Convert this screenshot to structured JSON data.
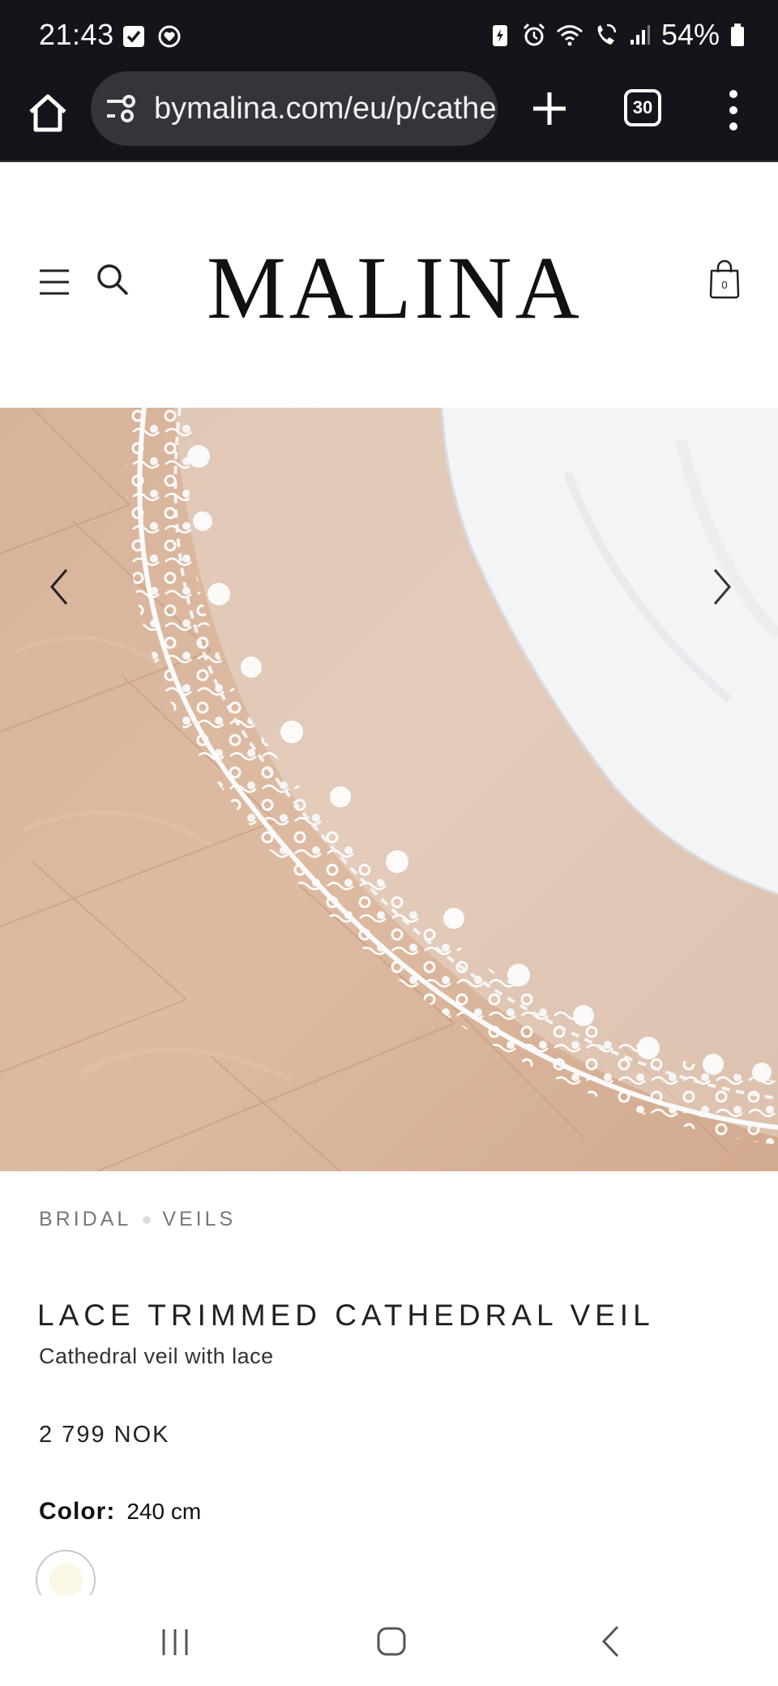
{
  "status_bar": {
    "time": "21:43",
    "battery": "54%",
    "icons": [
      "check-notification-icon",
      "heart-notification-icon",
      "battery-saver-icon",
      "alarm-icon",
      "wifi-icon",
      "wifi-call-icon",
      "signal-icon",
      "battery-icon"
    ]
  },
  "browser": {
    "url": "bymalina.com/eu/p/cathe",
    "tab_count": "30"
  },
  "header": {
    "logo": "MALINA",
    "cart_count": "0"
  },
  "product": {
    "breadcrumb": [
      "BRIDAL",
      "VEILS"
    ],
    "title": "LACE TRIMMED CATHEDRAL VEIL",
    "subtitle": "Cathedral veil with lace",
    "price": "2 799 NOK",
    "color_label": "Color:",
    "color_value": "240 cm",
    "swatch_color": "#fbf9e6"
  },
  "colors": {
    "chrome_bg": "#14151b",
    "url_pill": "#34353b",
    "floor": "#d8b49a"
  }
}
